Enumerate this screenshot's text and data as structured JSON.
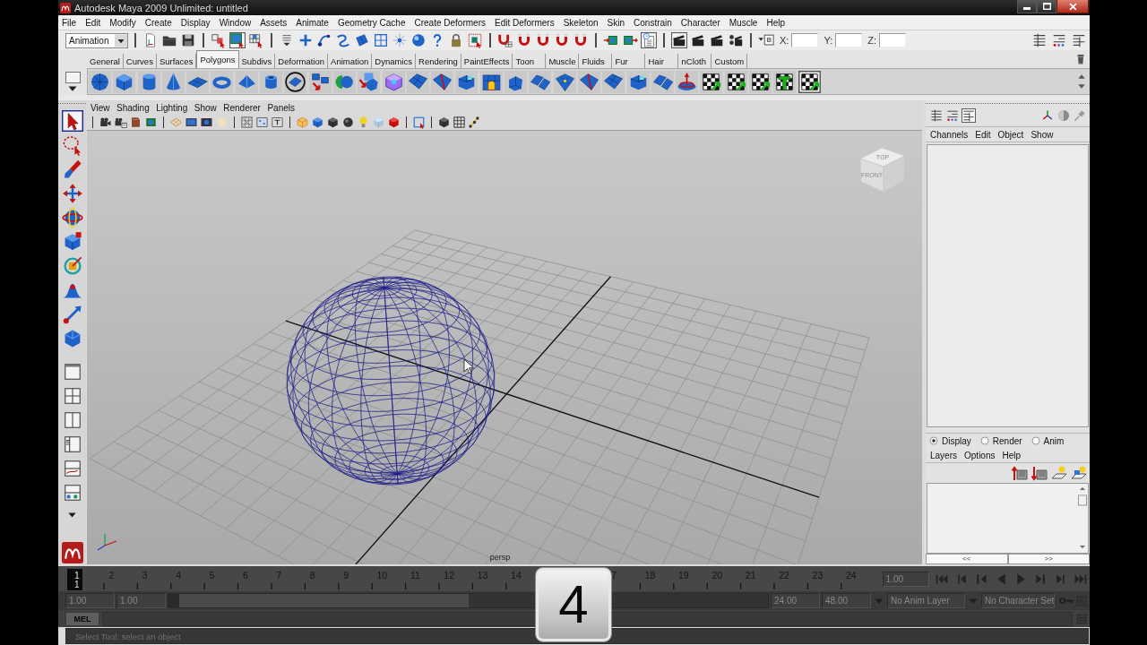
{
  "window": {
    "title": "Autodesk Maya 2009 Unlimited: untitled"
  },
  "menu_bar": [
    "File",
    "Edit",
    "Modify",
    "Create",
    "Display",
    "Window",
    "Assets",
    "Animate",
    "Geometry Cache",
    "Create Deformers",
    "Edit Deformers",
    "Skeleton",
    "Skin",
    "Constrain",
    "Character",
    "Muscle",
    "Help"
  ],
  "status_line": {
    "menu_set": "Animation",
    "buttons": [
      {
        "selected": false
      },
      {
        "selected": false
      },
      {
        "selected": false
      },
      {
        "selected": false
      },
      {
        "selected": true
      },
      {
        "selected": false
      },
      {
        "selected": false
      },
      {
        "selected": false
      },
      {
        "selected": false
      },
      {
        "selected": false
      },
      {
        "selected": false
      },
      {
        "selected": false
      },
      {
        "selected": false
      },
      {
        "selected": false
      },
      {
        "selected": false
      },
      {
        "selected": false
      },
      {
        "selected": false
      },
      {
        "selected": false
      },
      {
        "selected": false
      },
      {
        "selected": false
      },
      {
        "selected": false
      },
      {
        "selected": false
      },
      {
        "selected": false
      },
      {
        "selected": false
      },
      {
        "selected": true
      },
      {
        "selected": true
      },
      {
        "selected": false
      },
      {
        "selected": false
      },
      {
        "selected": false
      },
      {
        "selected": false
      }
    ],
    "coordinates": [
      "X:",
      "Y:",
      "Z:"
    ]
  },
  "shelf": {
    "tabs": [
      {
        "label": "General",
        "selected": false
      },
      {
        "label": "Curves",
        "selected": false
      },
      {
        "label": "Surfaces",
        "selected": false
      },
      {
        "label": "Polygons",
        "selected": true
      },
      {
        "label": "Subdivs",
        "selected": false
      },
      {
        "label": "Deformation",
        "selected": false
      },
      {
        "label": "Animation",
        "selected": false
      },
      {
        "label": "Dynamics",
        "selected": false
      },
      {
        "label": "Rendering",
        "selected": false
      },
      {
        "label": "PaintEffects",
        "selected": false
      },
      {
        "label": "Toon",
        "selected": false
      },
      {
        "label": "Muscle",
        "selected": false
      },
      {
        "label": "Fluids",
        "selected": false
      },
      {
        "label": "Fur",
        "selected": false
      },
      {
        "label": "Hair",
        "selected": false
      },
      {
        "label": "nCloth",
        "selected": false
      },
      {
        "label": "Custom",
        "selected": false
      }
    ],
    "buttons": [
      {
        "selected": false
      },
      {
        "selected": false
      },
      {
        "selected": false
      },
      {
        "selected": false
      },
      {
        "selected": false
      },
      {
        "selected": false
      },
      {
        "selected": false
      },
      {
        "selected": false
      },
      {
        "selected": false
      },
      {
        "selected": false
      },
      {
        "selected": false
      },
      {
        "selected": false
      },
      {
        "selected": false
      },
      {
        "selected": false
      },
      {
        "selected": false
      },
      {
        "selected": false
      },
      {
        "selected": false
      },
      {
        "selected": false
      },
      {
        "selected": false
      },
      {
        "selected": false
      },
      {
        "selected": false
      },
      {
        "selected": false
      },
      {
        "selected": false
      },
      {
        "selected": false
      },
      {
        "selected": false
      },
      {
        "selected": false
      },
      {
        "selected": false
      },
      {
        "selected": false
      },
      {
        "selected": false
      },
      {
        "selected": true
      }
    ]
  },
  "toolbox": {
    "tools": [
      {
        "selected": true
      },
      {
        "selected": false
      },
      {
        "selected": false
      },
      {
        "selected": false
      },
      {
        "selected": false
      },
      {
        "selected": false
      },
      {
        "selected": false
      },
      {
        "selected": false
      },
      {
        "selected": false
      },
      {
        "selected": false
      }
    ]
  },
  "viewport": {
    "menus": [
      "View",
      "Shading",
      "Lighting",
      "Show",
      "Renderer",
      "Panels"
    ],
    "view_cube": {
      "top": "TOP",
      "front": "FRONT"
    },
    "camera": "persp"
  },
  "channel_box": {
    "modes": [
      {
        "selected": false
      },
      {
        "selected": false
      },
      {
        "selected": true
      }
    ],
    "menus": [
      "Channels",
      "Edit",
      "Object",
      "Show"
    ]
  },
  "layer_editor": {
    "modes": [
      {
        "label": "Display",
        "selected": true
      },
      {
        "label": "Render",
        "selected": false
      },
      {
        "label": "Anim",
        "selected": false
      }
    ],
    "menus": [
      "Layers",
      "Options",
      "Help"
    ],
    "page_buttons": [
      "<<",
      ">>"
    ]
  },
  "time_slider": {
    "frames_left_of_overlay": [
      {
        "label": "1",
        "current": true
      },
      {
        "label": "2",
        "current": false
      },
      {
        "label": "3",
        "current": false
      },
      {
        "label": "4",
        "current": false
      },
      {
        "label": "5",
        "current": false
      },
      {
        "label": "6",
        "current": false
      },
      {
        "label": "7",
        "current": false
      },
      {
        "label": "8",
        "current": false
      },
      {
        "label": "9",
        "current": false
      },
      {
        "label": "10",
        "current": false
      },
      {
        "label": "11",
        "current": false
      },
      {
        "label": "12",
        "current": false
      },
      {
        "label": "13",
        "current": false
      },
      {
        "label": "14",
        "current": false
      }
    ],
    "frames_right_of_overlay": [
      {
        "label": "7",
        "current": false
      },
      {
        "label": "18",
        "current": false
      },
      {
        "label": "19",
        "current": false
      },
      {
        "label": "20",
        "current": false
      },
      {
        "label": "21",
        "current": false
      },
      {
        "label": "22",
        "current": false
      },
      {
        "label": "23",
        "current": false
      },
      {
        "label": "24",
        "current": false
      }
    ],
    "current_frame": "1",
    "current_time": "1.00"
  },
  "range_slider": {
    "start_time": "1.00",
    "playback_start": "1.00",
    "level": 0.5,
    "playback_end": "24.00",
    "end_time": "48.00",
    "anim_layer": "No Anim Layer",
    "character_set": "No Character Set"
  },
  "command_line": {
    "language": "MEL"
  },
  "help_line": "Select Tool: select an object",
  "key_overlay": "4"
}
